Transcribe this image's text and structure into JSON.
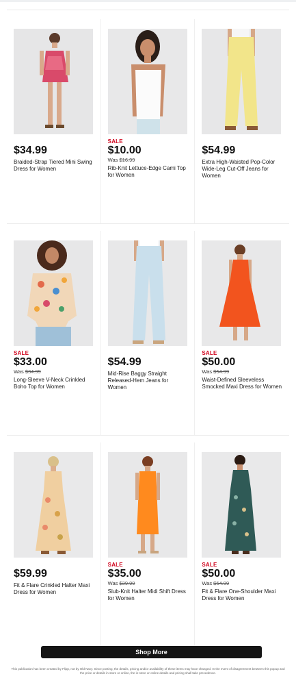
{
  "colors": {
    "sale": "#d0021b",
    "button": "#151515"
  },
  "products": [
    {
      "sale_label": "",
      "price": "$34.99",
      "was_label": "",
      "was_price": "",
      "name": "Braided-Strap Tiered Mini Swing Dress for Women",
      "image": "pink-mini-dress-model"
    },
    {
      "sale_label": "SALE",
      "price": "$10.00",
      "was_label": "Was",
      "was_price": "$16.99",
      "name": "Rib-Knit Lettuce-Edge Cami Top for Women",
      "image": "white-cami-top-model"
    },
    {
      "sale_label": "",
      "price": "$54.99",
      "was_label": "",
      "was_price": "",
      "name": "Extra High-Waisted Pop-Color Wide-Leg Cut-Off Jeans for Women",
      "image": "yellow-wide-leg-jeans-model"
    },
    {
      "sale_label": "SALE",
      "price": "$33.00",
      "was_label": "Was",
      "was_price": "$34.99",
      "name": "Long-Sleeve V-Neck Crinkled Boho Top for Women",
      "image": "floral-boho-top-model"
    },
    {
      "sale_label": "",
      "price": "$54.99",
      "was_label": "",
      "was_price": "",
      "name": "Mid-Rise Baggy Straight Released-Hem Jeans for Women",
      "image": "light-wash-jeans-model"
    },
    {
      "sale_label": "SALE",
      "price": "$50.00",
      "was_label": "Was",
      "was_price": "$54.99",
      "name": "Waist-Defined Sleeveless Smocked Maxi Dress for Women",
      "image": "orange-maxi-dress-model"
    },
    {
      "sale_label": "",
      "price": "$59.99",
      "was_label": "",
      "was_price": "",
      "name": "Fit & Flare Crinkled Halter Maxi Dress for Women",
      "image": "floral-halter-maxi-dress-model"
    },
    {
      "sale_label": "SALE",
      "price": "$35.00",
      "was_label": "Was",
      "was_price": "$39.99",
      "name": "Slub-Knit Halter Midi Shift Dress for Women",
      "image": "orange-midi-dress-model"
    },
    {
      "sale_label": "SALE",
      "price": "$50.00",
      "was_label": "Was",
      "was_price": "$54.99",
      "name": "Fit & Flare One-Shoulder Maxi Dress for Women",
      "image": "teal-print-maxi-dress-model"
    }
  ],
  "shop_more_label": "Shop More",
  "footer_text": "This publication has been created by Flipp, not by Old Navy. Since posting, the details, pricing and/or availability of these items may have changed. In the event of disagreement between this popup and the price or details in-store or online, the in-store or online details and pricing shall take precedence."
}
